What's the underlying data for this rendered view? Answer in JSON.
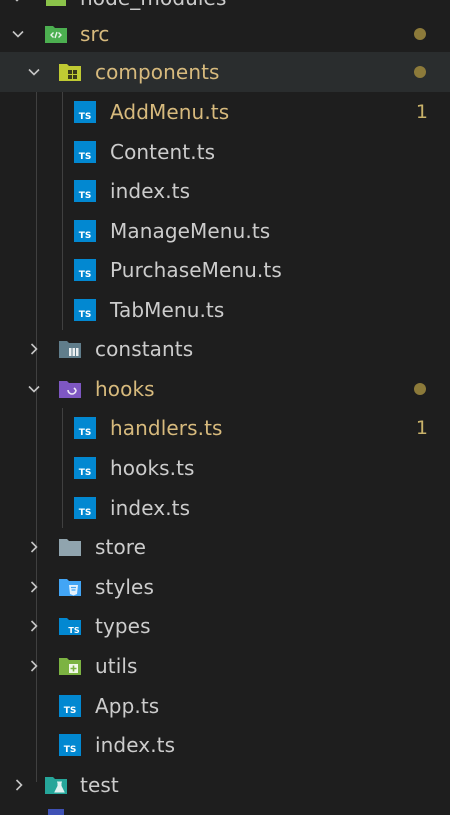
{
  "explorer": {
    "top_partial_label": "node_modules",
    "items": [
      {
        "label": "src",
        "kind": "folder",
        "icon": "src-folder-icon"
      },
      {
        "label": "components",
        "kind": "folder",
        "icon": "components-folder-icon"
      },
      {
        "label": "AddMenu.ts",
        "kind": "file",
        "icon": "typescript-file-icon",
        "problems": "1"
      },
      {
        "label": "Content.ts",
        "kind": "file",
        "icon": "typescript-file-icon"
      },
      {
        "label": "index.ts",
        "kind": "file",
        "icon": "typescript-file-icon"
      },
      {
        "label": "ManageMenu.ts",
        "kind": "file",
        "icon": "typescript-file-icon"
      },
      {
        "label": "PurchaseMenu.ts",
        "kind": "file",
        "icon": "typescript-file-icon"
      },
      {
        "label": "TabMenu.ts",
        "kind": "file",
        "icon": "typescript-file-icon"
      },
      {
        "label": "constants",
        "kind": "folder",
        "icon": "constants-folder-icon"
      },
      {
        "label": "hooks",
        "kind": "folder",
        "icon": "hooks-folder-icon"
      },
      {
        "label": "handlers.ts",
        "kind": "file",
        "icon": "typescript-file-icon",
        "problems": "1"
      },
      {
        "label": "hooks.ts",
        "kind": "file",
        "icon": "typescript-file-icon"
      },
      {
        "label": "index.ts",
        "kind": "file",
        "icon": "typescript-file-icon"
      },
      {
        "label": "store",
        "kind": "folder",
        "icon": "store-folder-icon"
      },
      {
        "label": "styles",
        "kind": "folder",
        "icon": "styles-folder-icon"
      },
      {
        "label": "types",
        "kind": "folder",
        "icon": "types-folder-icon"
      },
      {
        "label": "utils",
        "kind": "folder",
        "icon": "utils-folder-icon"
      },
      {
        "label": "App.ts",
        "kind": "file",
        "icon": "typescript-file-icon"
      },
      {
        "label": "index.ts",
        "kind": "file",
        "icon": "typescript-file-icon"
      },
      {
        "label": "test",
        "kind": "folder",
        "icon": "test-folder-icon"
      }
    ]
  },
  "colors": {
    "background": "#1e1e1e",
    "selected_row": "#2a2d2e",
    "modified_text": "#d7ba7d",
    "default_text": "#cccccc",
    "ts_icon": "#0288d1",
    "modified_dot": "#8c7a3a"
  }
}
